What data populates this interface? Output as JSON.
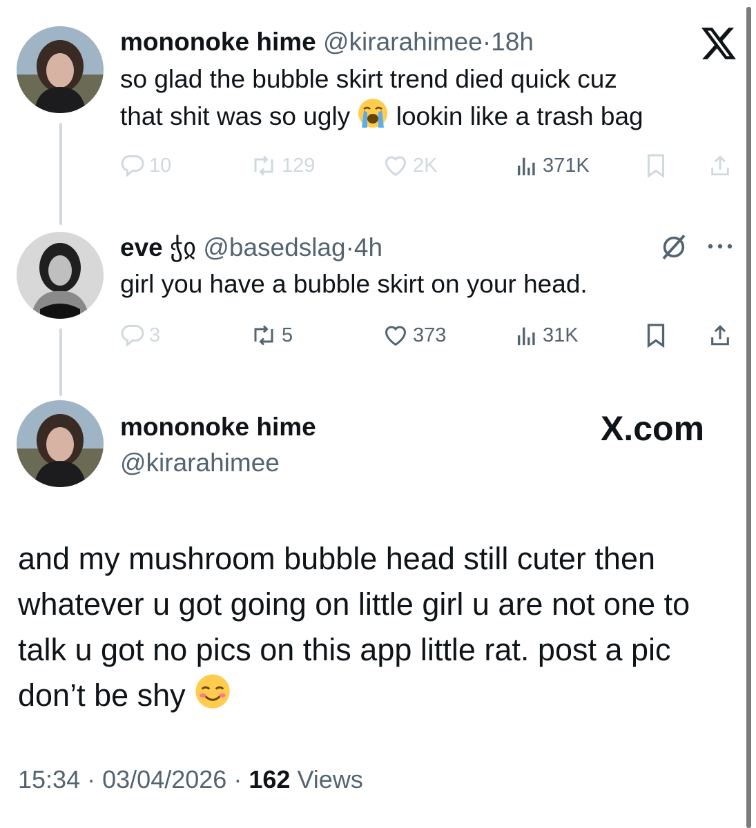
{
  "tweet1": {
    "name": "mononoke hime",
    "handle": "@kirarahimee",
    "sep": "·",
    "time": "18h",
    "text_line1": "so glad the bubble skirt trend died quick cuz",
    "text_line2a": "that shit was so ugly",
    "text_line2b": "lookin like a trash bag",
    "emoji": "loudly-crying-face",
    "replies": "10",
    "reposts": "129",
    "likes": "2K",
    "views": "371K"
  },
  "tweet2": {
    "name": "eve",
    "name_symbol": "ჭჲ",
    "handle": "@basedslag",
    "sep": "·",
    "time": "4h",
    "text": "girl you have a bubble skirt on your head.",
    "replies": "3",
    "reposts": "5",
    "likes": "373",
    "views": "31K"
  },
  "focus": {
    "name": "mononoke hime",
    "handle": "@kirarahimee",
    "brand": "X.com",
    "text_line1": "and my mushroom bubble head still cuter then",
    "text_line2": "whatever u got going on little girl u are not one to",
    "text_line3": "talk u got no pics on this app little rat. post a pic",
    "text_line4": "don’t be shy",
    "emoji": "smiling-face",
    "time": "15:34",
    "sep": "·",
    "date": "03/04/2026",
    "views_count": "162",
    "views_label": "Views"
  },
  "colors": {
    "text": "#0f1419",
    "secondary": "#536471",
    "faded": "#cfd9de",
    "thread_line": "#cfd9de"
  },
  "icons": [
    "x-logo-icon",
    "reply-icon",
    "repost-icon",
    "like-icon",
    "views-icon",
    "bookmark-icon",
    "share-icon",
    "grok-icon",
    "more-icon"
  ]
}
